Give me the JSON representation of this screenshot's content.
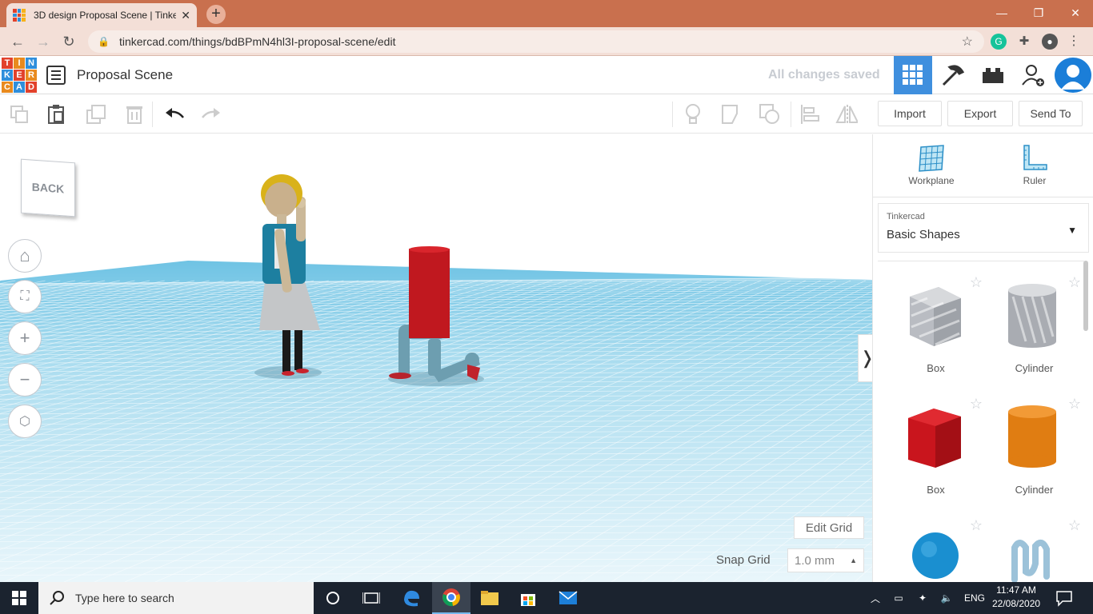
{
  "browser": {
    "tab_title": "3D design Proposal Scene | Tinke",
    "url": "tinkercad.com/things/bdBPmN4hl3I-proposal-scene/edit"
  },
  "header": {
    "project_title": "Proposal Scene",
    "save_status": "All changes saved",
    "logo_letters": [
      "T",
      "I",
      "N",
      "K",
      "E",
      "R",
      "C",
      "A",
      "D"
    ]
  },
  "toolbar": {
    "import_label": "Import",
    "export_label": "Export",
    "send_to_label": "Send To"
  },
  "viewport": {
    "view_cube_label": "BACK",
    "edit_grid_label": "Edit Grid",
    "snap_grid_label": "Snap Grid",
    "snap_grid_value": "1.0 mm"
  },
  "panel": {
    "workplane_label": "Workplane",
    "ruler_label": "Ruler",
    "library_category": "Tinkercad",
    "library_name": "Basic Shapes",
    "shapes": [
      {
        "label": "Box",
        "color": "#b9bcc2"
      },
      {
        "label": "Cylinder",
        "color": "#b9bcc2"
      },
      {
        "label": "Box",
        "color": "#d81e26"
      },
      {
        "label": "Cylinder",
        "color": "#e98a1e"
      }
    ]
  },
  "taskbar": {
    "search_placeholder": "Type here to search",
    "language": "ENG",
    "time": "11:47 AM",
    "date": "22/08/2020"
  }
}
